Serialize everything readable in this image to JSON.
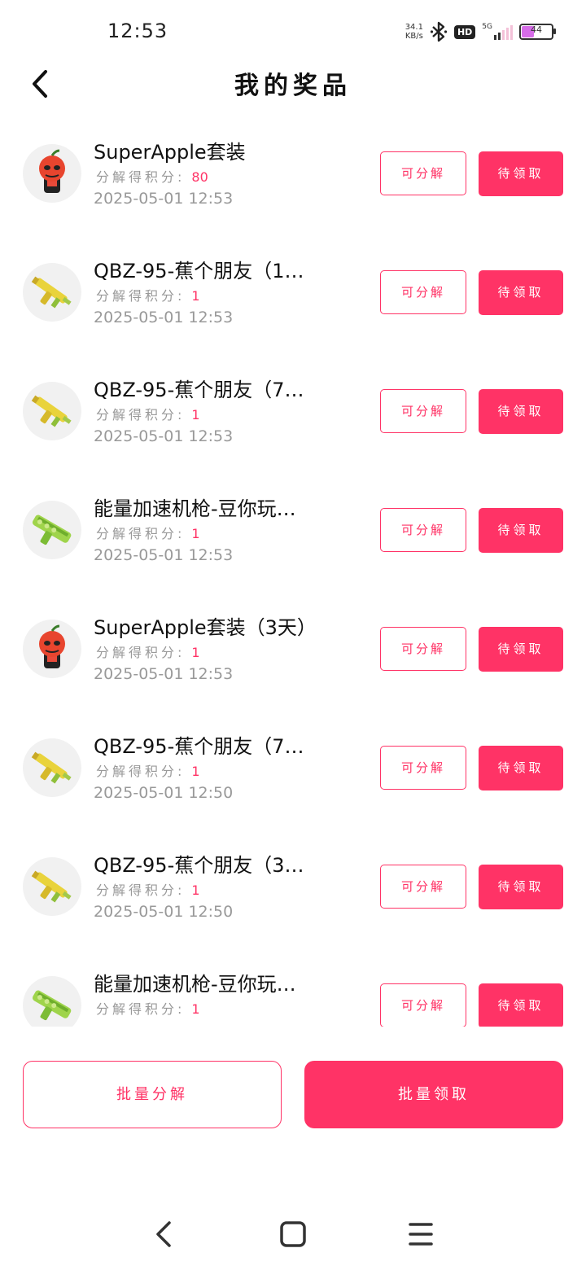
{
  "status_bar": {
    "time": "12:53",
    "net_speed_value": "34.1",
    "net_speed_unit": "KB/s",
    "hd_badge": "HD",
    "network_gen": "5G",
    "battery": "44",
    "battery_level": 0.44,
    "icons": [
      "bluetooth-icon",
      "signal-icon",
      "battery-icon"
    ]
  },
  "header": {
    "title": "我的奖品",
    "back_icon": "chevron-left-icon"
  },
  "colors": {
    "accent": "#ff3366",
    "muted_text": "#999999",
    "avatar_bg": "#f1f1f1"
  },
  "labels": {
    "points_label": "分解得积分:",
    "decompose_button": "可分解",
    "claim_button": "待领取"
  },
  "prizes": [
    {
      "name": "SuperApple套装",
      "points": "80",
      "time": "2025-05-01 12:53",
      "icon": "apple-character-icon"
    },
    {
      "name": "QBZ-95-蕉个朋友（1…",
      "points": "1",
      "time": "2025-05-01 12:53",
      "icon": "banana-gun-icon"
    },
    {
      "name": "QBZ-95-蕉个朋友（7…",
      "points": "1",
      "time": "2025-05-01 12:53",
      "icon": "banana-gun-icon"
    },
    {
      "name": "能量加速机枪-豆你玩…",
      "points": "1",
      "time": "2025-05-01 12:53",
      "icon": "bean-machine-gun-icon"
    },
    {
      "name": "SuperApple套装（3天）",
      "points": "1",
      "time": "2025-05-01 12:53",
      "icon": "apple-character-icon"
    },
    {
      "name": "QBZ-95-蕉个朋友（7…",
      "points": "1",
      "time": "2025-05-01 12:50",
      "icon": "banana-gun-icon"
    },
    {
      "name": "QBZ-95-蕉个朋友（3…",
      "points": "1",
      "time": "2025-05-01 12:50",
      "icon": "banana-gun-icon"
    },
    {
      "name": "能量加速机枪-豆你玩…",
      "points": "1",
      "time": "",
      "icon": "bean-machine-gun-icon"
    }
  ],
  "batch": {
    "decompose_label": "批量分解",
    "claim_label": "批量领取"
  },
  "system_nav": [
    "back-icon",
    "home-icon",
    "menu-icon"
  ]
}
